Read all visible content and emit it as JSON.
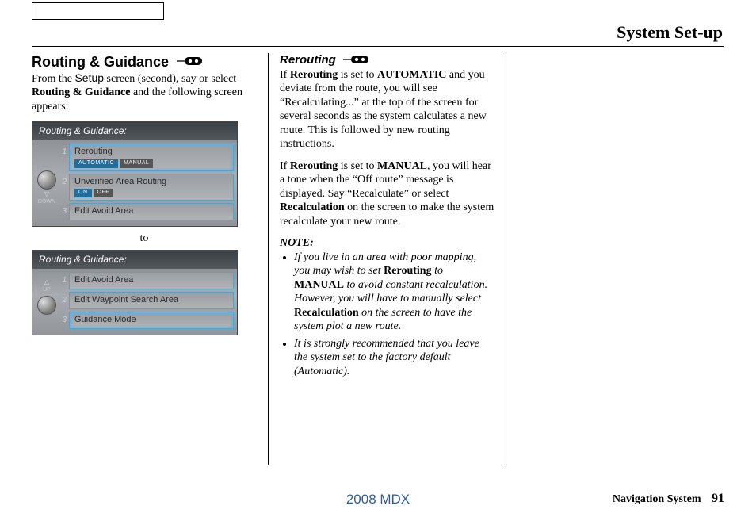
{
  "header": {
    "title": "System Set-up"
  },
  "column1": {
    "heading": "Routing & Guidance",
    "intro_prefix": "From the ",
    "intro_setup": "Setup",
    "intro_mid": " screen (second), say or select ",
    "intro_bold": "Routing & Guidance",
    "intro_suffix": " and the following screen appears:",
    "between": "to",
    "screenshot1": {
      "title": "Routing & Guidance:",
      "dial_label_top": "",
      "dial_label_bottom": "DOWN",
      "rows": [
        {
          "num": "1",
          "label": "Rerouting",
          "toggle_on": "AUTOMATIC",
          "toggle_off": "MANUAL",
          "highlight": true
        },
        {
          "num": "2",
          "label": "Unverified Area Routing",
          "toggle_on": "ON",
          "toggle_off": "OFF"
        },
        {
          "num": "3",
          "label": "Edit Avoid Area"
        }
      ]
    },
    "screenshot2": {
      "title": "Routing & Guidance:",
      "dial_label_top": "UP",
      "dial_label_bottom": "",
      "rows": [
        {
          "num": "1",
          "label": "Edit Avoid Area"
        },
        {
          "num": "2",
          "label": "Edit Waypoint Search Area"
        },
        {
          "num": "3",
          "label": "Guidance Mode",
          "highlight": true
        }
      ]
    }
  },
  "column2": {
    "heading": "Rerouting",
    "p1_a": "If ",
    "p1_b": "Rerouting",
    "p1_c": " is set to ",
    "p1_d": "AUTOMATIC",
    "p1_e": " and you deviate from the route, you will see “Recalculating...” at the top of the screen for several seconds as the system calculates a new route. This is followed by new routing instructions.",
    "p2_a": "If ",
    "p2_b": "Rerouting",
    "p2_c": " is set to ",
    "p2_d": "MANUAL",
    "p2_e": ", you will hear a tone when the “Off route” message is displayed. Say “Recalculate” or select ",
    "p2_f": "Recalculation",
    "p2_g": " on the screen to make the system recalculate your new route.",
    "note_label": "NOTE:",
    "note1_a": "If you live in an area with poor mapping, you may wish to set ",
    "note1_b": "Rerouting",
    "note1_c": " to ",
    "note1_d": "MANUAL",
    "note1_e": " to avoid constant recalculation. However, you will have to manually select ",
    "note1_f": "Recalculation",
    "note1_g": " on the screen to have the system plot a new route.",
    "note2": "It is strongly recommended that you leave the system set to the factory default (Automatic)."
  },
  "footer": {
    "center": "2008  MDX",
    "right_label": "Navigation System",
    "page": "91"
  }
}
